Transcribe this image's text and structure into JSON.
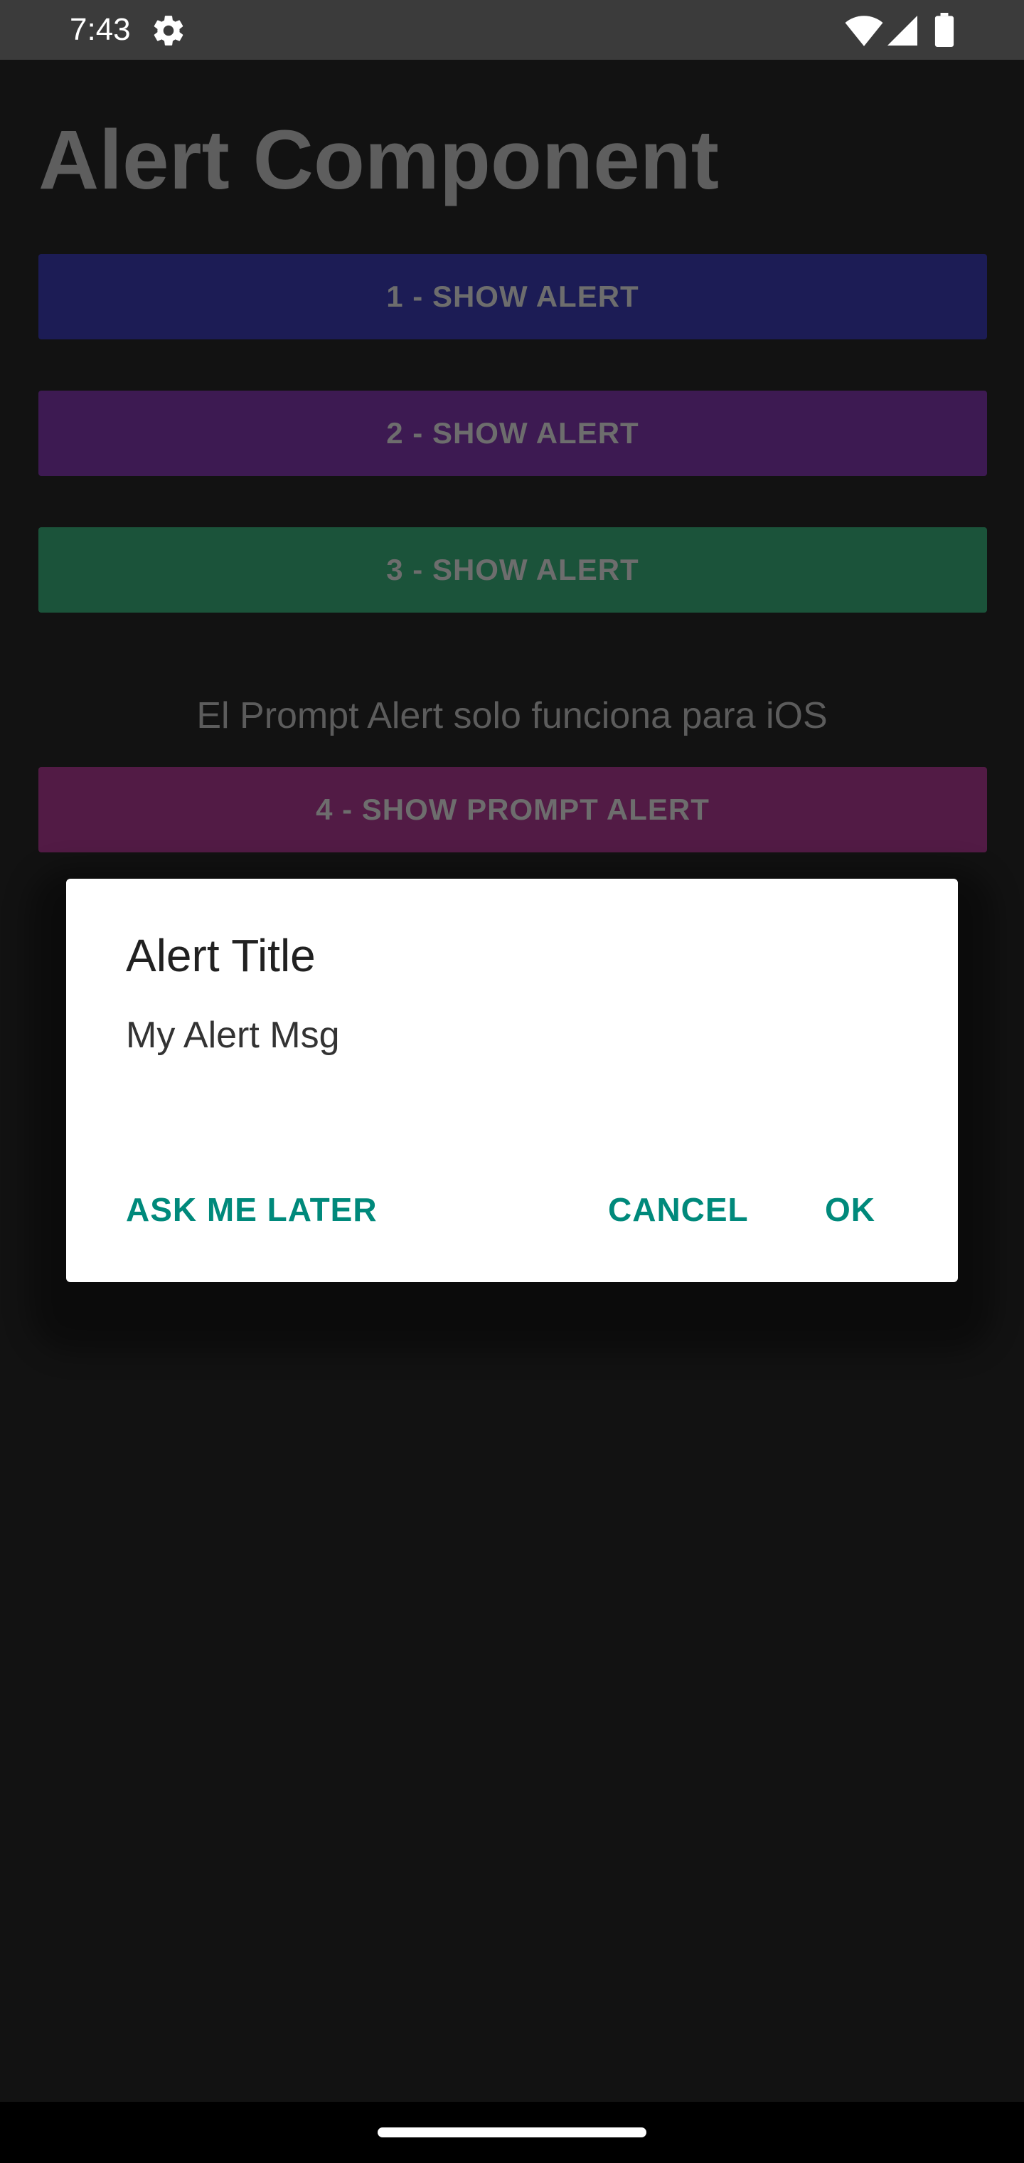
{
  "status_bar": {
    "time": "7:43",
    "icons": [
      "gear-icon",
      "wifi-icon",
      "signal-icon",
      "battery-icon"
    ]
  },
  "page": {
    "title": "Alert Component",
    "buttons": [
      {
        "label": "1 - SHOW ALERT",
        "color": "#1c1c55"
      },
      {
        "label": "2 - SHOW ALERT",
        "color": "#3d1a52"
      },
      {
        "label": "3 - SHOW ALERT",
        "color": "#1b533a"
      }
    ],
    "ios_note": "El Prompt Alert solo funciona para iOS",
    "prompt_button": {
      "label": "4 - SHOW PROMPT ALERT",
      "color": "#521b45"
    }
  },
  "dialog": {
    "title": "Alert Title",
    "message": "My Alert Msg",
    "actions": {
      "ask_later": "ASK ME LATER",
      "cancel": "CANCEL",
      "ok": "OK"
    },
    "accent_color": "#00897b"
  }
}
